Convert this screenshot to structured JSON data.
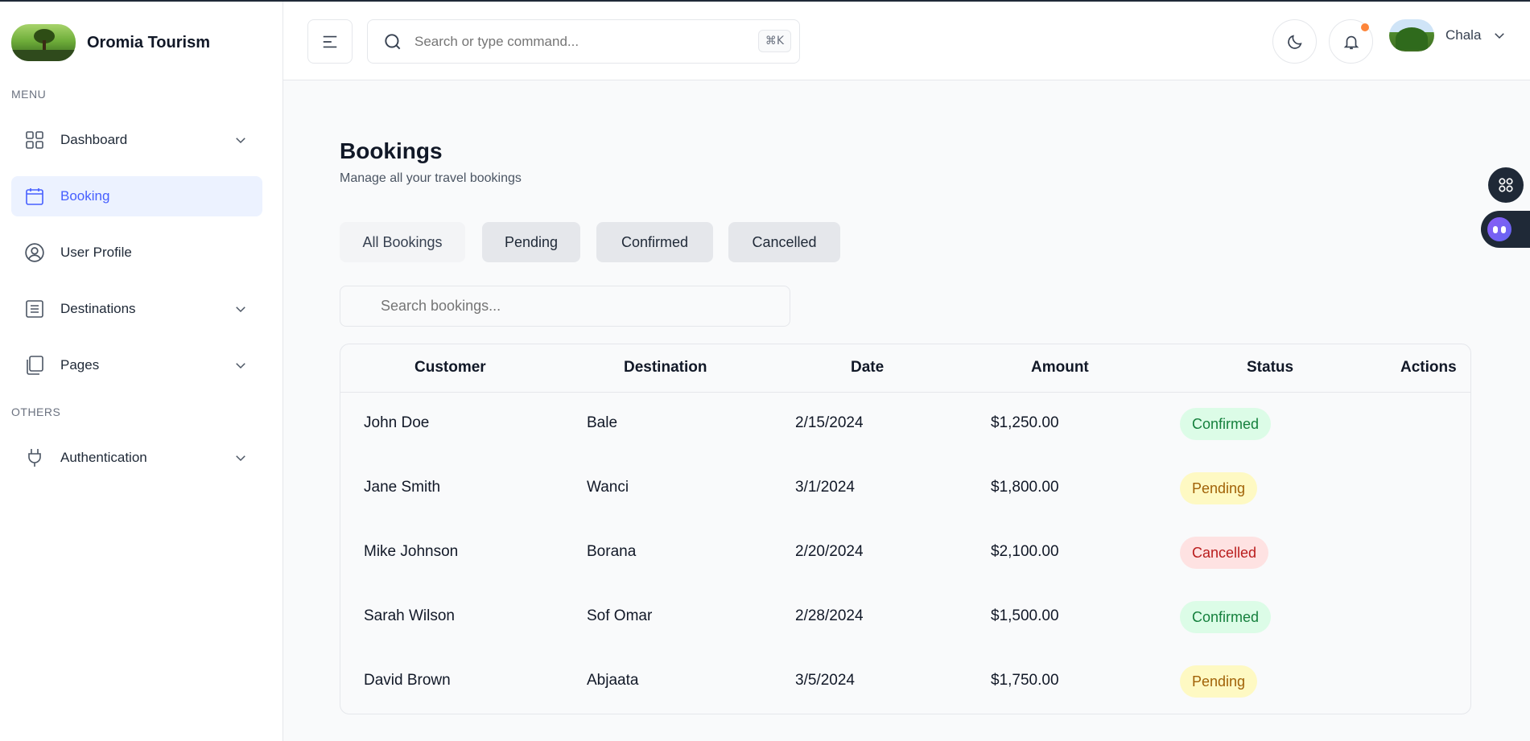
{
  "brand": {
    "name": "Oromia Tourism"
  },
  "sidebar": {
    "menu_label": "MENU",
    "others_label": "OTHERS",
    "items": [
      {
        "label": "Dashboard",
        "icon": "grid-icon",
        "has_chevron": true
      },
      {
        "label": "Booking",
        "icon": "calendar-icon",
        "active": true
      },
      {
        "label": "User Profile",
        "icon": "user-circle-icon"
      },
      {
        "label": "Destinations",
        "icon": "list-icon",
        "has_chevron": true
      },
      {
        "label": "Pages",
        "icon": "pages-icon",
        "has_chevron": true
      }
    ],
    "others": [
      {
        "label": "Authentication",
        "icon": "plug-icon",
        "has_chevron": true
      }
    ]
  },
  "header": {
    "search_placeholder": "Search or type command...",
    "shortcut": "⌘K",
    "user_name": "Chala"
  },
  "main": {
    "title": "Bookings",
    "subtitle": "Manage all your travel bookings",
    "filters": [
      "All Bookings",
      "Pending",
      "Confirmed",
      "Cancelled"
    ],
    "table_search_placeholder": "Search bookings...",
    "columns": [
      "Customer",
      "Destination",
      "Date",
      "Amount",
      "Status",
      "Actions"
    ],
    "rows": [
      {
        "customer": "John Doe",
        "destination": "Bale",
        "date": "2/15/2024",
        "amount": "$1,250.00",
        "status": "Confirmed"
      },
      {
        "customer": "Jane Smith",
        "destination": "Wanci",
        "date": "3/1/2024",
        "amount": "$1,800.00",
        "status": "Pending"
      },
      {
        "customer": "Mike Johnson",
        "destination": "Borana",
        "date": "2/20/2024",
        "amount": "$2,100.00",
        "status": "Cancelled"
      },
      {
        "customer": "Sarah Wilson",
        "destination": "Sof Omar",
        "date": "2/28/2024",
        "amount": "$1,500.00",
        "status": "Confirmed"
      },
      {
        "customer": "David Brown",
        "destination": "Abjaata",
        "date": "3/5/2024",
        "amount": "$1,750.00",
        "status": "Pending"
      }
    ]
  },
  "colors": {
    "accent": "#465fff",
    "confirmed": "#15803d",
    "pending": "#a16207",
    "cancelled": "#b91c1c",
    "notification": "#fd853a"
  }
}
